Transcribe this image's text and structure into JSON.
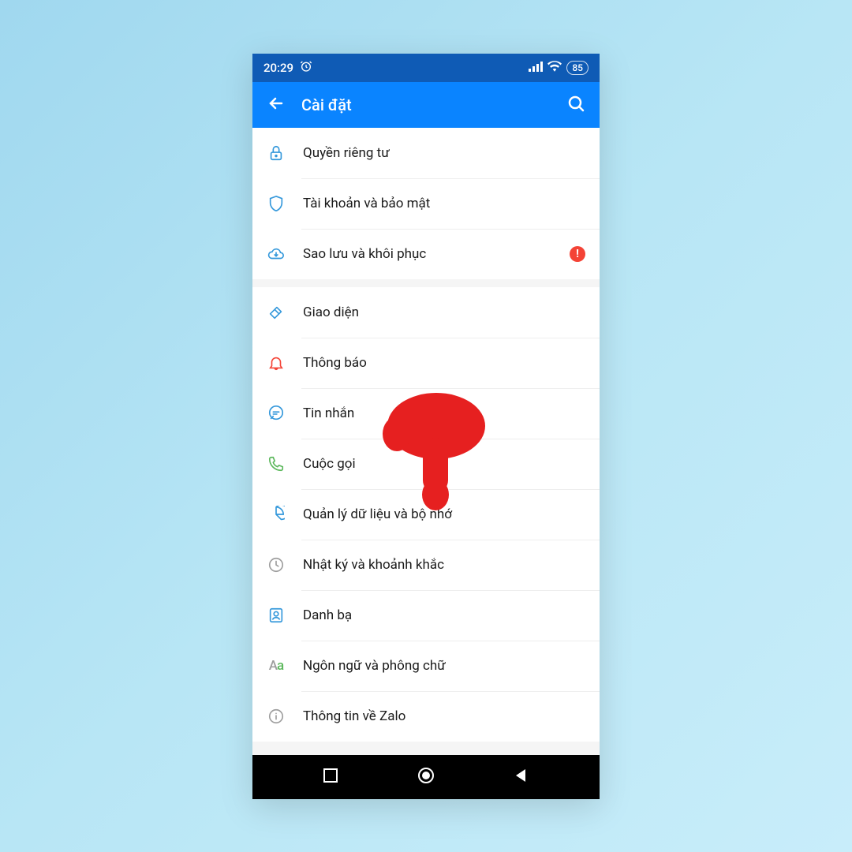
{
  "status": {
    "time": "20:29",
    "battery": "85"
  },
  "header": {
    "title": "Cài đặt"
  },
  "sections": [
    {
      "rows": [
        {
          "label": "Quyền riêng tư"
        },
        {
          "label": "Tài khoản và bảo mật"
        },
        {
          "label": "Sao lưu và khôi phục"
        }
      ]
    },
    {
      "rows": [
        {
          "label": "Giao diện"
        },
        {
          "label": "Thông báo"
        },
        {
          "label": "Tin nhắn"
        },
        {
          "label": "Cuộc gọi"
        },
        {
          "label": "Quản lý dữ liệu và bộ nhớ"
        },
        {
          "label": "Nhật ký và khoảnh khắc"
        },
        {
          "label": "Danh bạ"
        },
        {
          "label": "Ngôn ngữ và phông chữ"
        },
        {
          "label": "Thông tin về Zalo"
        }
      ]
    }
  ],
  "colors": {
    "accent_blue": "#3498db",
    "accent_red": "#f44336",
    "accent_green": "#5cb85c",
    "text_gray": "#9e9e9e"
  }
}
